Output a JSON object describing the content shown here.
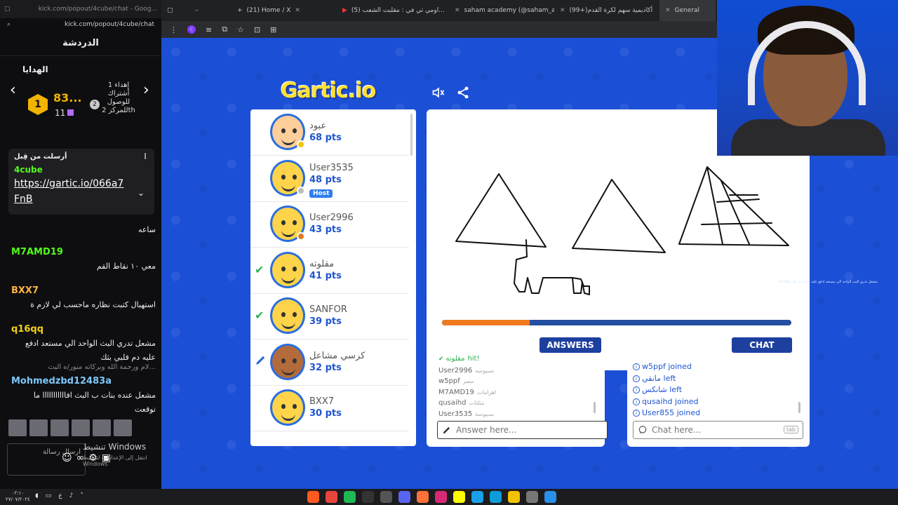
{
  "left_window": {
    "title": "kick.com/popout/4cube/chat - Goog...",
    "url": "kick.com/popout/4cube/chat",
    "header": "الدردشة",
    "gifts_label": "الهدايا",
    "rank": {
      "position": "1",
      "value": "83...",
      "count": "11"
    },
    "second": {
      "position": "2",
      "desc": "إهداء 1 أشتراك للوصول للمركز 2th"
    },
    "pinned": {
      "label": "أرسلت من قِبل",
      "user": "4cube",
      "link": "https://gartic.io/066a7FnB"
    },
    "messages": [
      {
        "user": "",
        "text": "ساعه"
      },
      {
        "user": "M7AMD19",
        "text": "معي ١٠ نقاط القم"
      },
      {
        "user": "BXX7",
        "text": "استهبال كتبت نظاره ماحسب لي لازم ة"
      },
      {
        "user": "q16qq",
        "text": "مشعل تدري البث الواحد الي مستعد ادفع عليه دم قلبي بثك"
      },
      {
        "user": "",
        "text": "...لام ورحمة الله وبركاته منور/ه البث"
      },
      {
        "user": "Mohmedzbd12483a",
        "text": "مشعل عنده بنات ب البث افااااااااااا ما توقعت"
      }
    ],
    "input_placeholder": "ارسال رسالة",
    "windows_activate": "تنشيط Windows",
    "windows_activate_sub": "انتقل إلى الإعدادات لتنشيط Windows"
  },
  "browser": {
    "tabs": [
      {
        "label": "(21) Home / X"
      },
      {
        "label": "(5) اومي تي في : مقلبت الشعب..."
      },
      {
        "label": "saham academy (@saham_ac..."
      },
      {
        "label": "(99+)أكاديمية سهم لكرة القدم"
      },
      {
        "label": "General"
      }
    ]
  },
  "game": {
    "logo": "Gartic",
    "logo_io": ".io",
    "players": [
      {
        "name": "عبود",
        "pts": "68 pts",
        "check": false,
        "drawing": false,
        "host": false,
        "avatar": "hair",
        "status": "#f4c20d"
      },
      {
        "name": "User3535",
        "pts": "48 pts",
        "check": false,
        "drawing": false,
        "host": true,
        "avatar": "plain",
        "status": "#bbbbbb"
      },
      {
        "name": "User2996",
        "pts": "43 pts",
        "check": false,
        "drawing": false,
        "host": false,
        "avatar": "plain",
        "status": "#e07b20"
      },
      {
        "name": "مقلوته",
        "pts": "41 pts",
        "check": true,
        "drawing": false,
        "host": false,
        "avatar": "plain",
        "status": ""
      },
      {
        "name": "SANFOR",
        "pts": "39 pts",
        "check": true,
        "drawing": false,
        "host": false,
        "avatar": "plain",
        "status": ""
      },
      {
        "name": "كرسي مشاعل",
        "pts": "32 pts",
        "check": false,
        "drawing": true,
        "host": false,
        "avatar": "hair-dark",
        "status": ""
      },
      {
        "name": "BXX7",
        "pts": "30 pts",
        "check": false,
        "drawing": false,
        "host": false,
        "avatar": "plain",
        "status": ""
      }
    ],
    "host_label": "Host",
    "timer_progress": 0.25,
    "overlay_text": "q16qq: مشعل تدري البث الواحد الي مستعد ادفع عليه دم قلبي بثك",
    "answers_tab": "ANSWERS",
    "chat_tab": "CHAT",
    "answers": [
      {
        "user": "مقلوته",
        "word": "hit!",
        "hit": true
      },
      {
        "user": "User2996",
        "word": "سبيوسه",
        "hit": false
      },
      {
        "user": "w5ppf",
        "word": "مصر",
        "hit": false
      },
      {
        "user": "M7AMD19",
        "word": "اهرامات",
        "hit": false
      },
      {
        "user": "qusaihd",
        "word": "مثلثات",
        "hit": false
      },
      {
        "user": "User3535",
        "word": "سبيوسة",
        "hit": false
      }
    ],
    "chat_events": [
      {
        "user": "w5ppf",
        "event": "joined"
      },
      {
        "user": "مانقي",
        "event": "left"
      },
      {
        "user": "شانكس",
        "event": "left"
      },
      {
        "user": "qusaihd",
        "event": "joined"
      },
      {
        "user": "User855",
        "event": "joined"
      }
    ],
    "answer_placeholder": "Answer here...",
    "chat_placeholder": "Chat here...",
    "tab_hint": "tab"
  },
  "taskbar": {
    "time": "٠٢:١٠",
    "date": "٢٧/٠٧/٢٠٢٤",
    "lang": "ع"
  },
  "icons": {
    "sound": "speaker-icon",
    "share": "share-icon",
    "pencil": "pencil-icon",
    "check": "check-icon",
    "chat_bubble": "chat-bubble-icon"
  }
}
